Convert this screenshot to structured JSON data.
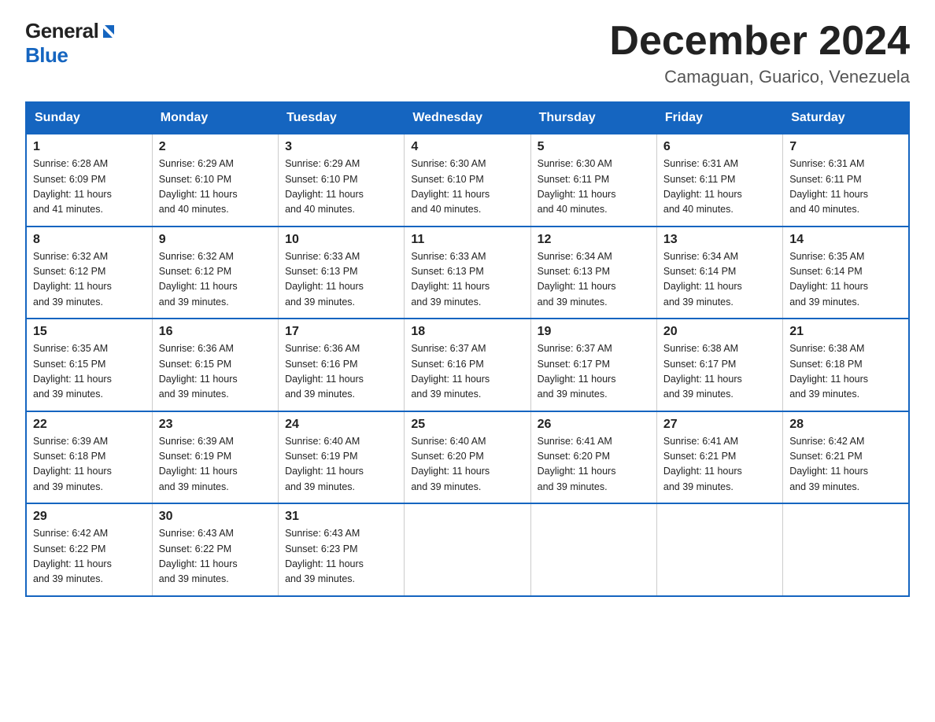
{
  "header": {
    "logo_general": "General",
    "logo_blue": "Blue",
    "main_title": "December 2024",
    "subtitle": "Camaguan, Guarico, Venezuela"
  },
  "calendar": {
    "days_of_week": [
      "Sunday",
      "Monday",
      "Tuesday",
      "Wednesday",
      "Thursday",
      "Friday",
      "Saturday"
    ],
    "weeks": [
      [
        {
          "day": "1",
          "sunrise": "6:28 AM",
          "sunset": "6:09 PM",
          "daylight": "11 hours and 41 minutes."
        },
        {
          "day": "2",
          "sunrise": "6:29 AM",
          "sunset": "6:10 PM",
          "daylight": "11 hours and 40 minutes."
        },
        {
          "day": "3",
          "sunrise": "6:29 AM",
          "sunset": "6:10 PM",
          "daylight": "11 hours and 40 minutes."
        },
        {
          "day": "4",
          "sunrise": "6:30 AM",
          "sunset": "6:10 PM",
          "daylight": "11 hours and 40 minutes."
        },
        {
          "day": "5",
          "sunrise": "6:30 AM",
          "sunset": "6:11 PM",
          "daylight": "11 hours and 40 minutes."
        },
        {
          "day": "6",
          "sunrise": "6:31 AM",
          "sunset": "6:11 PM",
          "daylight": "11 hours and 40 minutes."
        },
        {
          "day": "7",
          "sunrise": "6:31 AM",
          "sunset": "6:11 PM",
          "daylight": "11 hours and 40 minutes."
        }
      ],
      [
        {
          "day": "8",
          "sunrise": "6:32 AM",
          "sunset": "6:12 PM",
          "daylight": "11 hours and 39 minutes."
        },
        {
          "day": "9",
          "sunrise": "6:32 AM",
          "sunset": "6:12 PM",
          "daylight": "11 hours and 39 minutes."
        },
        {
          "day": "10",
          "sunrise": "6:33 AM",
          "sunset": "6:13 PM",
          "daylight": "11 hours and 39 minutes."
        },
        {
          "day": "11",
          "sunrise": "6:33 AM",
          "sunset": "6:13 PM",
          "daylight": "11 hours and 39 minutes."
        },
        {
          "day": "12",
          "sunrise": "6:34 AM",
          "sunset": "6:13 PM",
          "daylight": "11 hours and 39 minutes."
        },
        {
          "day": "13",
          "sunrise": "6:34 AM",
          "sunset": "6:14 PM",
          "daylight": "11 hours and 39 minutes."
        },
        {
          "day": "14",
          "sunrise": "6:35 AM",
          "sunset": "6:14 PM",
          "daylight": "11 hours and 39 minutes."
        }
      ],
      [
        {
          "day": "15",
          "sunrise": "6:35 AM",
          "sunset": "6:15 PM",
          "daylight": "11 hours and 39 minutes."
        },
        {
          "day": "16",
          "sunrise": "6:36 AM",
          "sunset": "6:15 PM",
          "daylight": "11 hours and 39 minutes."
        },
        {
          "day": "17",
          "sunrise": "6:36 AM",
          "sunset": "6:16 PM",
          "daylight": "11 hours and 39 minutes."
        },
        {
          "day": "18",
          "sunrise": "6:37 AM",
          "sunset": "6:16 PM",
          "daylight": "11 hours and 39 minutes."
        },
        {
          "day": "19",
          "sunrise": "6:37 AM",
          "sunset": "6:17 PM",
          "daylight": "11 hours and 39 minutes."
        },
        {
          "day": "20",
          "sunrise": "6:38 AM",
          "sunset": "6:17 PM",
          "daylight": "11 hours and 39 minutes."
        },
        {
          "day": "21",
          "sunrise": "6:38 AM",
          "sunset": "6:18 PM",
          "daylight": "11 hours and 39 minutes."
        }
      ],
      [
        {
          "day": "22",
          "sunrise": "6:39 AM",
          "sunset": "6:18 PM",
          "daylight": "11 hours and 39 minutes."
        },
        {
          "day": "23",
          "sunrise": "6:39 AM",
          "sunset": "6:19 PM",
          "daylight": "11 hours and 39 minutes."
        },
        {
          "day": "24",
          "sunrise": "6:40 AM",
          "sunset": "6:19 PM",
          "daylight": "11 hours and 39 minutes."
        },
        {
          "day": "25",
          "sunrise": "6:40 AM",
          "sunset": "6:20 PM",
          "daylight": "11 hours and 39 minutes."
        },
        {
          "day": "26",
          "sunrise": "6:41 AM",
          "sunset": "6:20 PM",
          "daylight": "11 hours and 39 minutes."
        },
        {
          "day": "27",
          "sunrise": "6:41 AM",
          "sunset": "6:21 PM",
          "daylight": "11 hours and 39 minutes."
        },
        {
          "day": "28",
          "sunrise": "6:42 AM",
          "sunset": "6:21 PM",
          "daylight": "11 hours and 39 minutes."
        }
      ],
      [
        {
          "day": "29",
          "sunrise": "6:42 AM",
          "sunset": "6:22 PM",
          "daylight": "11 hours and 39 minutes."
        },
        {
          "day": "30",
          "sunrise": "6:43 AM",
          "sunset": "6:22 PM",
          "daylight": "11 hours and 39 minutes."
        },
        {
          "day": "31",
          "sunrise": "6:43 AM",
          "sunset": "6:23 PM",
          "daylight": "11 hours and 39 minutes."
        },
        null,
        null,
        null,
        null
      ]
    ],
    "labels": {
      "sunrise": "Sunrise: ",
      "sunset": "Sunset: ",
      "daylight": "Daylight: "
    }
  }
}
